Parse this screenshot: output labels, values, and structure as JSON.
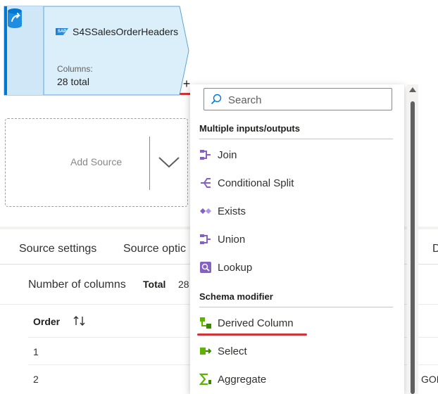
{
  "node": {
    "title": "S4SSalesOrderHeaders",
    "sap_badge": "SAP",
    "columns_label": "Columns:",
    "columns_count": "28 total"
  },
  "add_source": {
    "label": "Add Source"
  },
  "tabs": {
    "source_settings": "Source settings",
    "source_options": "Source optic",
    "clipped": "D"
  },
  "columns": {
    "label": "Number of columns",
    "total_label": "Total",
    "total_value": "28"
  },
  "table": {
    "header_order": "Order",
    "rows": [
      "1",
      "2"
    ],
    "clipped_text": "GOR"
  },
  "menu": {
    "search_placeholder": "Search",
    "sections": [
      {
        "header": "Multiple inputs/outputs",
        "items": [
          "Join",
          "Conditional Split",
          "Exists",
          "Union",
          "Lookup"
        ]
      },
      {
        "header": "Schema modifier",
        "items": [
          "Derived Column",
          "Select",
          "Aggregate"
        ]
      }
    ]
  },
  "colors": {
    "accent": "#0078d4",
    "node_fill": "#dbeffa",
    "highlight": "#d13438",
    "icon_purple": "#8661c5",
    "icon_green": "#5db300"
  }
}
